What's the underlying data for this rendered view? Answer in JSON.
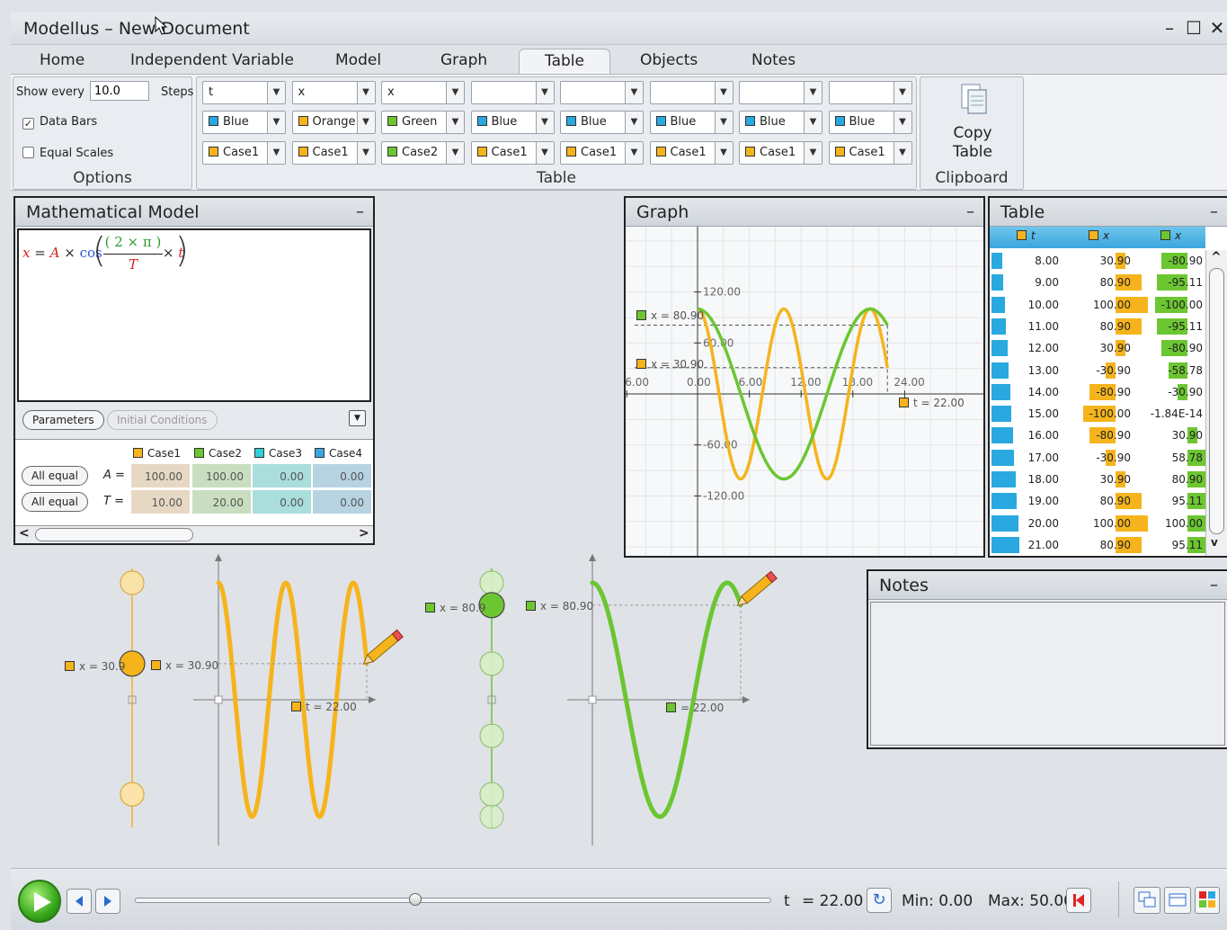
{
  "window": {
    "title": "Modellus – New Document",
    "controls": [
      "–",
      "☐",
      "✕"
    ]
  },
  "menu_tabs": [
    {
      "label": "Home",
      "active": false
    },
    {
      "label": "Independent Variable",
      "active": false
    },
    {
      "label": "Model",
      "active": false
    },
    {
      "label": "Graph",
      "active": false
    },
    {
      "label": "Table",
      "active": true
    },
    {
      "label": "Objects",
      "active": false
    },
    {
      "label": "Notes",
      "active": false
    }
  ],
  "ribbon": {
    "options": {
      "show_every_label": "Show every",
      "show_every_value": "10.0",
      "steps_label": "Steps",
      "data_bars_label": "Data Bars",
      "data_bars_checked": true,
      "equal_scales_label": "Equal Scales",
      "equal_scales_checked": false,
      "group_label": "Options"
    },
    "table": {
      "group_label": "Table",
      "columns": [
        {
          "var": "t",
          "color": "Blue",
          "color_hex": "#2aa8e0",
          "case": "Case1",
          "case_hex": "#f6b41c"
        },
        {
          "var": "x",
          "color": "Orange",
          "color_hex": "#f6b41c",
          "case": "Case1",
          "case_hex": "#f6b41c"
        },
        {
          "var": "x",
          "color": "Green",
          "color_hex": "#6cc631",
          "case": "Case2",
          "case_hex": "#6cc631"
        },
        {
          "var": "",
          "color": "Blue",
          "color_hex": "#2aa8e0",
          "case": "Case1",
          "case_hex": "#f6b41c"
        },
        {
          "var": "",
          "color": "Blue",
          "color_hex": "#2aa8e0",
          "case": "Case1",
          "case_hex": "#f6b41c"
        },
        {
          "var": "",
          "color": "Blue",
          "color_hex": "#2aa8e0",
          "case": "Case1",
          "case_hex": "#f6b41c"
        },
        {
          "var": "",
          "color": "Blue",
          "color_hex": "#2aa8e0",
          "case": "Case1",
          "case_hex": "#f6b41c"
        },
        {
          "var": "",
          "color": "Blue",
          "color_hex": "#2aa8e0",
          "case": "Case1",
          "case_hex": "#f6b41c"
        }
      ]
    },
    "clipboard": {
      "button_line1": "Copy",
      "button_line2": "Table",
      "group_label": "Clipboard"
    }
  },
  "model_panel": {
    "title": "Mathematical Model",
    "minimize": "–",
    "equation": {
      "lhs": "x",
      "eq": "=",
      "A": "A",
      "times": "×",
      "cos": "cos",
      "num": "( 2 × π )",
      "den": "T",
      "t": "t"
    },
    "tab_parameters": "Parameters",
    "tab_initial": "Initial Conditions",
    "cases": [
      {
        "name": "Case1",
        "hex": "#f6b41c",
        "bg": "#e7d8c4"
      },
      {
        "name": "Case2",
        "hex": "#6cc631",
        "bg": "#c9dec0"
      },
      {
        "name": "Case3",
        "hex": "#30d0d8",
        "bg": "#a9dedd"
      },
      {
        "name": "Case4",
        "hex": "#3aa6dc",
        "bg": "#b7d3e2"
      }
    ],
    "params": [
      {
        "button": "All equal",
        "name": "A =",
        "values": [
          "100.00",
          "100.00",
          "0.00",
          "0.00"
        ]
      },
      {
        "button": "All equal",
        "name": "T =",
        "values": [
          "10.00",
          "20.00",
          "0.00",
          "0.00"
        ]
      }
    ]
  },
  "graph_panel": {
    "title": "Graph",
    "minimize": "–",
    "y_ticks": [
      "120.00",
      "60.00",
      "-60.00",
      "-120.00"
    ],
    "x_ticks": [
      "6.00",
      "0.00",
      "6.00",
      "12.00",
      "18.00",
      "24.00"
    ],
    "label_x_green": "x = 80.90",
    "label_x_orange": "x = 30.90",
    "label_t": "t = 22.00"
  },
  "chart_data": {
    "type": "line",
    "xlabel": "t",
    "ylabel": "x",
    "xlim": [
      -6,
      24
    ],
    "ylim": [
      -120,
      120
    ],
    "series": [
      {
        "name": "x (Case1)",
        "color": "#f6b41c",
        "function": "100*cos(2*pi*t/10)",
        "t_range": [
          0,
          22
        ]
      },
      {
        "name": "x (Case2)",
        "color": "#6cc631",
        "function": "100*cos(2*pi*t/20)",
        "t_range": [
          0,
          22
        ]
      }
    ],
    "grid": true
  },
  "table_panel": {
    "title": "Table",
    "minimize": "–",
    "headers": [
      "t",
      "x",
      "x"
    ],
    "header_hex": [
      "#f6b41c",
      "#f6b41c",
      "#6cc631"
    ],
    "rows": [
      [
        "8.00",
        "30.90",
        "-80.90"
      ],
      [
        "9.00",
        "80.90",
        "-95.11"
      ],
      [
        "10.00",
        "100.00",
        "-100.00"
      ],
      [
        "11.00",
        "80.90",
        "-95.11"
      ],
      [
        "12.00",
        "30.90",
        "-80.90"
      ],
      [
        "13.00",
        "-30.90",
        "-58.78"
      ],
      [
        "14.00",
        "-80.90",
        "-30.90"
      ],
      [
        "15.00",
        "-100.00",
        "-1.84E-14"
      ],
      [
        "16.00",
        "-80.90",
        "30.90"
      ],
      [
        "17.00",
        "-30.90",
        "58.78"
      ],
      [
        "18.00",
        "30.90",
        "80.90"
      ],
      [
        "19.00",
        "80.90",
        "95.11"
      ],
      [
        "20.00",
        "100.00",
        "100.00"
      ],
      [
        "21.00",
        "80.90",
        "95.11"
      ]
    ]
  },
  "notes_panel": {
    "title": "Notes",
    "minimize": "–"
  },
  "objects": {
    "orange_particle_label": "x = 30.9",
    "orange_graph_label": "x = 30.90",
    "orange_t_label": "t = 22.00",
    "green_particle_label": "x = 80.9",
    "green_graph_label": "x = 80.90",
    "green_t_label": "= 22.00"
  },
  "player": {
    "t_label": "t",
    "t_value": "= 22.00",
    "min_label": "Min: 0.00",
    "max_label": "Max: 50.00",
    "progress_fraction": 0.44
  }
}
